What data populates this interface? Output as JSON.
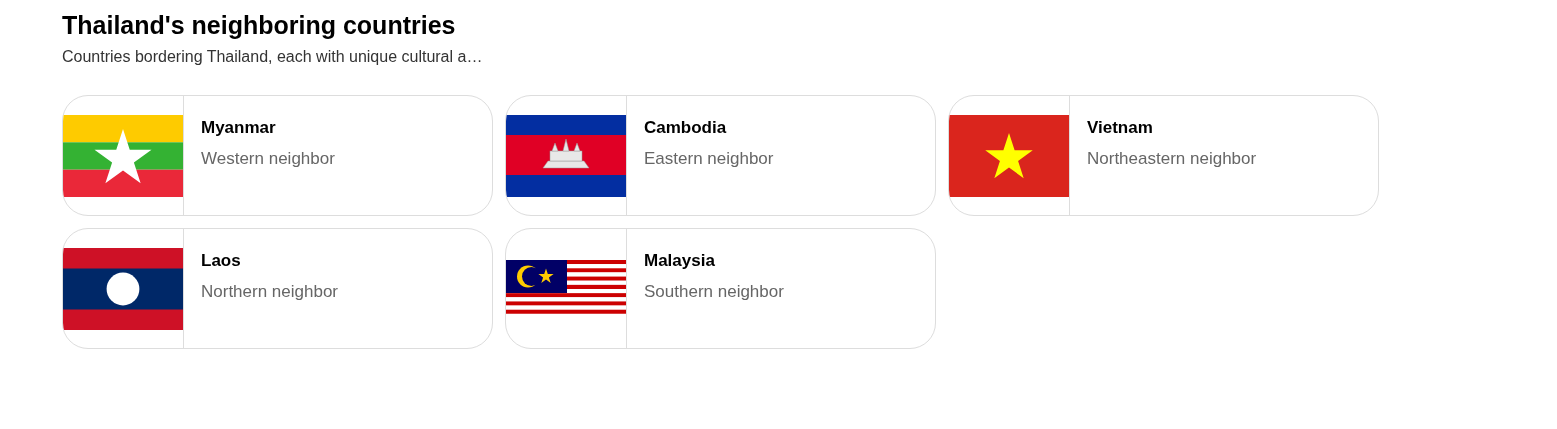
{
  "title": "Thailand's neighboring countries",
  "subtitle": "Countries bordering Thailand, each with unique cultural a…",
  "countries": [
    {
      "name": "Myanmar",
      "description": "Western neighbor",
      "kind": "myanmar"
    },
    {
      "name": "Cambodia",
      "description": "Eastern neighbor",
      "kind": "cambodia"
    },
    {
      "name": "Vietnam",
      "description": "Northeastern neighbor",
      "kind": "vietnam"
    },
    {
      "name": "Laos",
      "description": "Northern neighbor",
      "kind": "laos"
    },
    {
      "name": "Malaysia",
      "description": "Southern neighbor",
      "kind": "malaysia"
    }
  ]
}
